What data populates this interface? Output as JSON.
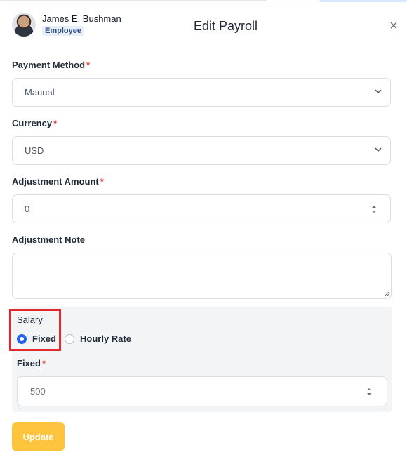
{
  "employee": {
    "name": "James E. Bushman",
    "role_badge": "Employee"
  },
  "modal": {
    "title": "Edit Payroll",
    "close_icon": "close-icon"
  },
  "payment_method": {
    "label": "Payment Method",
    "required_mark": "*",
    "value": "Manual"
  },
  "currency": {
    "label": "Currency",
    "required_mark": "*",
    "value": "USD"
  },
  "adjustment_amount": {
    "label": "Adjustment Amount",
    "required_mark": "*",
    "value": "0"
  },
  "adjustment_note": {
    "label": "Adjustment Note",
    "value": ""
  },
  "salary": {
    "label": "Salary",
    "options": [
      {
        "label": "Fixed",
        "selected": true
      },
      {
        "label": "Hourly Rate",
        "selected": false
      }
    ],
    "fixed_label": "Fixed",
    "fixed_required_mark": "*",
    "fixed_value": "500"
  },
  "actions": {
    "update_label": "Update"
  },
  "colors": {
    "accent": "#2563eb",
    "button": "#fdc53d",
    "required": "#ef4444",
    "highlight": "#e5262b"
  }
}
